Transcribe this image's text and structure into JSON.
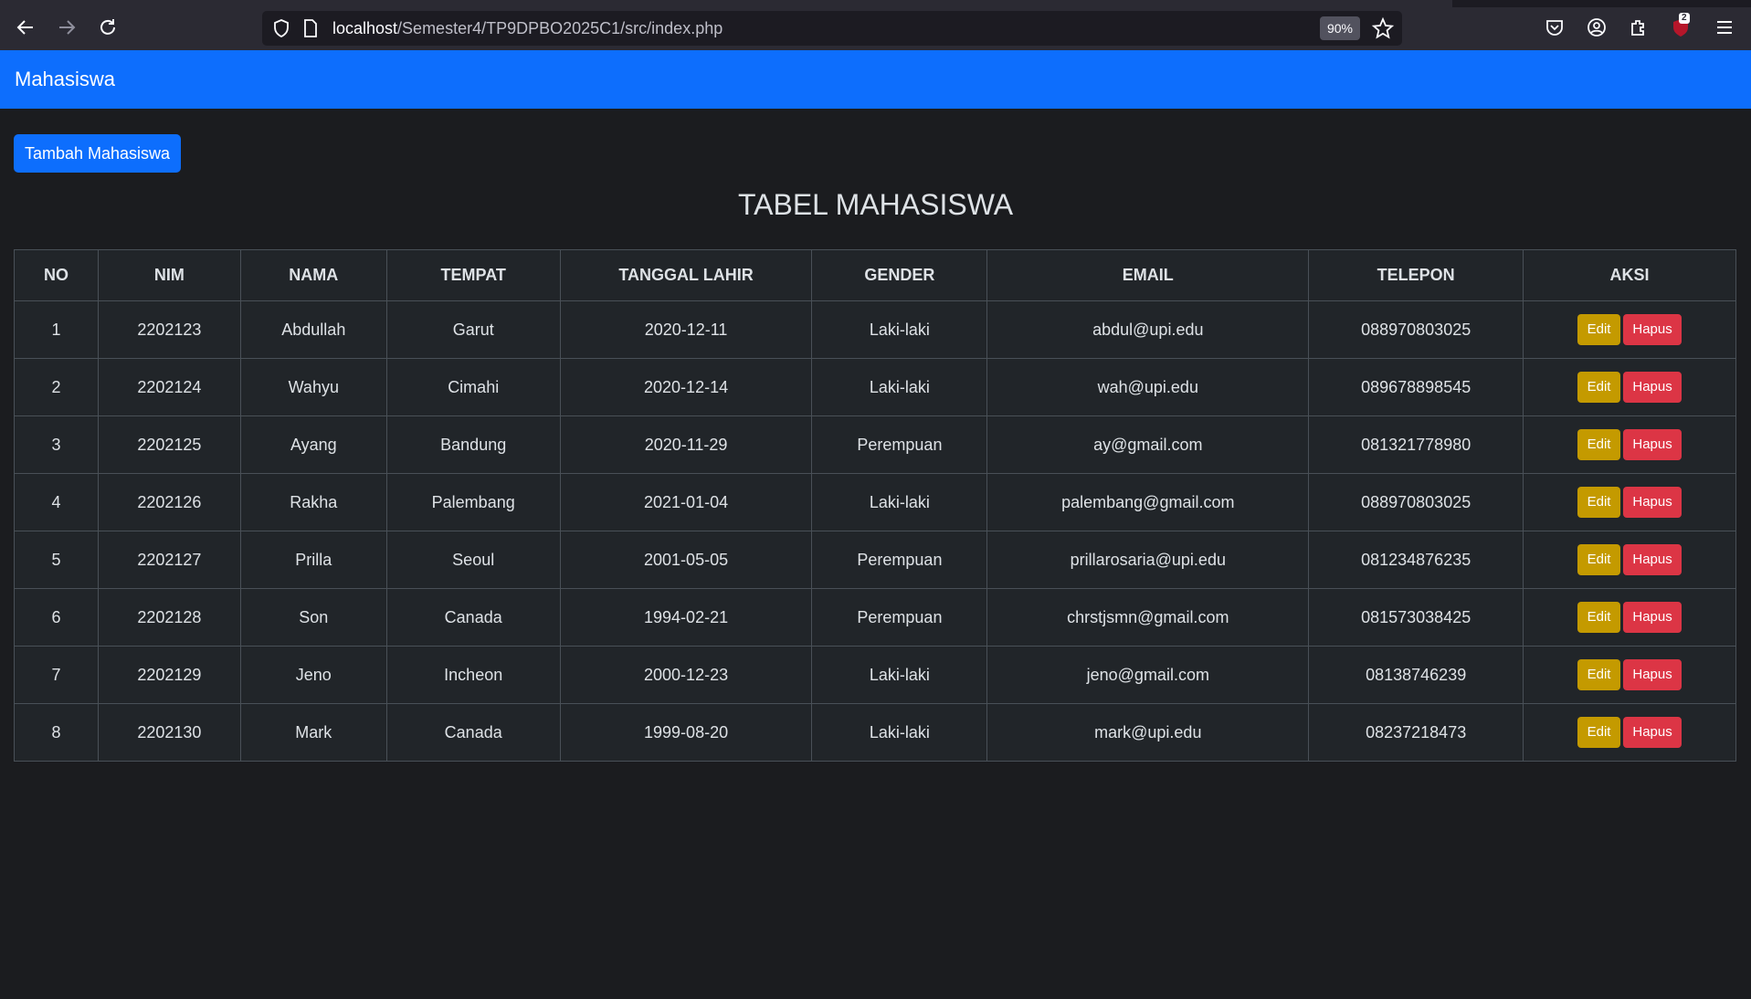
{
  "browser": {
    "url_host": "localhost",
    "url_path": "/Semester4/TP9DPBO2025C1/src/index.php",
    "zoom": "90%",
    "extension_badge": "2",
    "icons": [
      "back-icon",
      "forward-icon",
      "reload-icon",
      "shield-icon",
      "page-icon",
      "star-icon",
      "pocket-icon",
      "account-icon",
      "extensions-icon",
      "ublock-icon",
      "menu-icon"
    ]
  },
  "navbar": {
    "brand": "Mahasiswa"
  },
  "actions": {
    "add_label": "Tambah Mahasiswa"
  },
  "page_title": "TABEL MAHASISWA",
  "table": {
    "headers": [
      "NO",
      "NIM",
      "NAMA",
      "TEMPAT",
      "TANGGAL LAHIR",
      "GENDER",
      "EMAIL",
      "TELEPON",
      "AKSI"
    ],
    "rows": [
      [
        "1",
        "2202123",
        "Abdullah",
        "Garut",
        "2020-12-11",
        "Laki-laki",
        "abdul@upi.edu",
        "088970803025"
      ],
      [
        "2",
        "2202124",
        "Wahyu",
        "Cimahi",
        "2020-12-14",
        "Laki-laki",
        "wah@upi.edu",
        "089678898545"
      ],
      [
        "3",
        "2202125",
        "Ayang",
        "Bandung",
        "2020-11-29",
        "Perempuan",
        "ay@gmail.com",
        "081321778980"
      ],
      [
        "4",
        "2202126",
        "Rakha",
        "Palembang",
        "2021-01-04",
        "Laki-laki",
        "palembang@gmail.com",
        "088970803025"
      ],
      [
        "5",
        "2202127",
        "Prilla",
        "Seoul",
        "2001-05-05",
        "Perempuan",
        "prillarosaria@upi.edu",
        "081234876235"
      ],
      [
        "6",
        "2202128",
        "Son",
        "Canada",
        "1994-02-21",
        "Perempuan",
        "chrstjsmn@gmail.com",
        "081573038425"
      ],
      [
        "7",
        "2202129",
        "Jeno",
        "Incheon",
        "2000-12-23",
        "Laki-laki",
        "jeno@gmail.com",
        "08138746239"
      ],
      [
        "8",
        "2202130",
        "Mark",
        "Canada",
        "1999-08-20",
        "Laki-laki",
        "mark@upi.edu",
        "08237218473"
      ]
    ],
    "edit_label": "Edit",
    "delete_label": "Hapus"
  },
  "colors": {
    "navbar": "#0d6efd",
    "edit": "#c49a00",
    "delete": "#dc3545",
    "background": "#1b1c1f"
  }
}
